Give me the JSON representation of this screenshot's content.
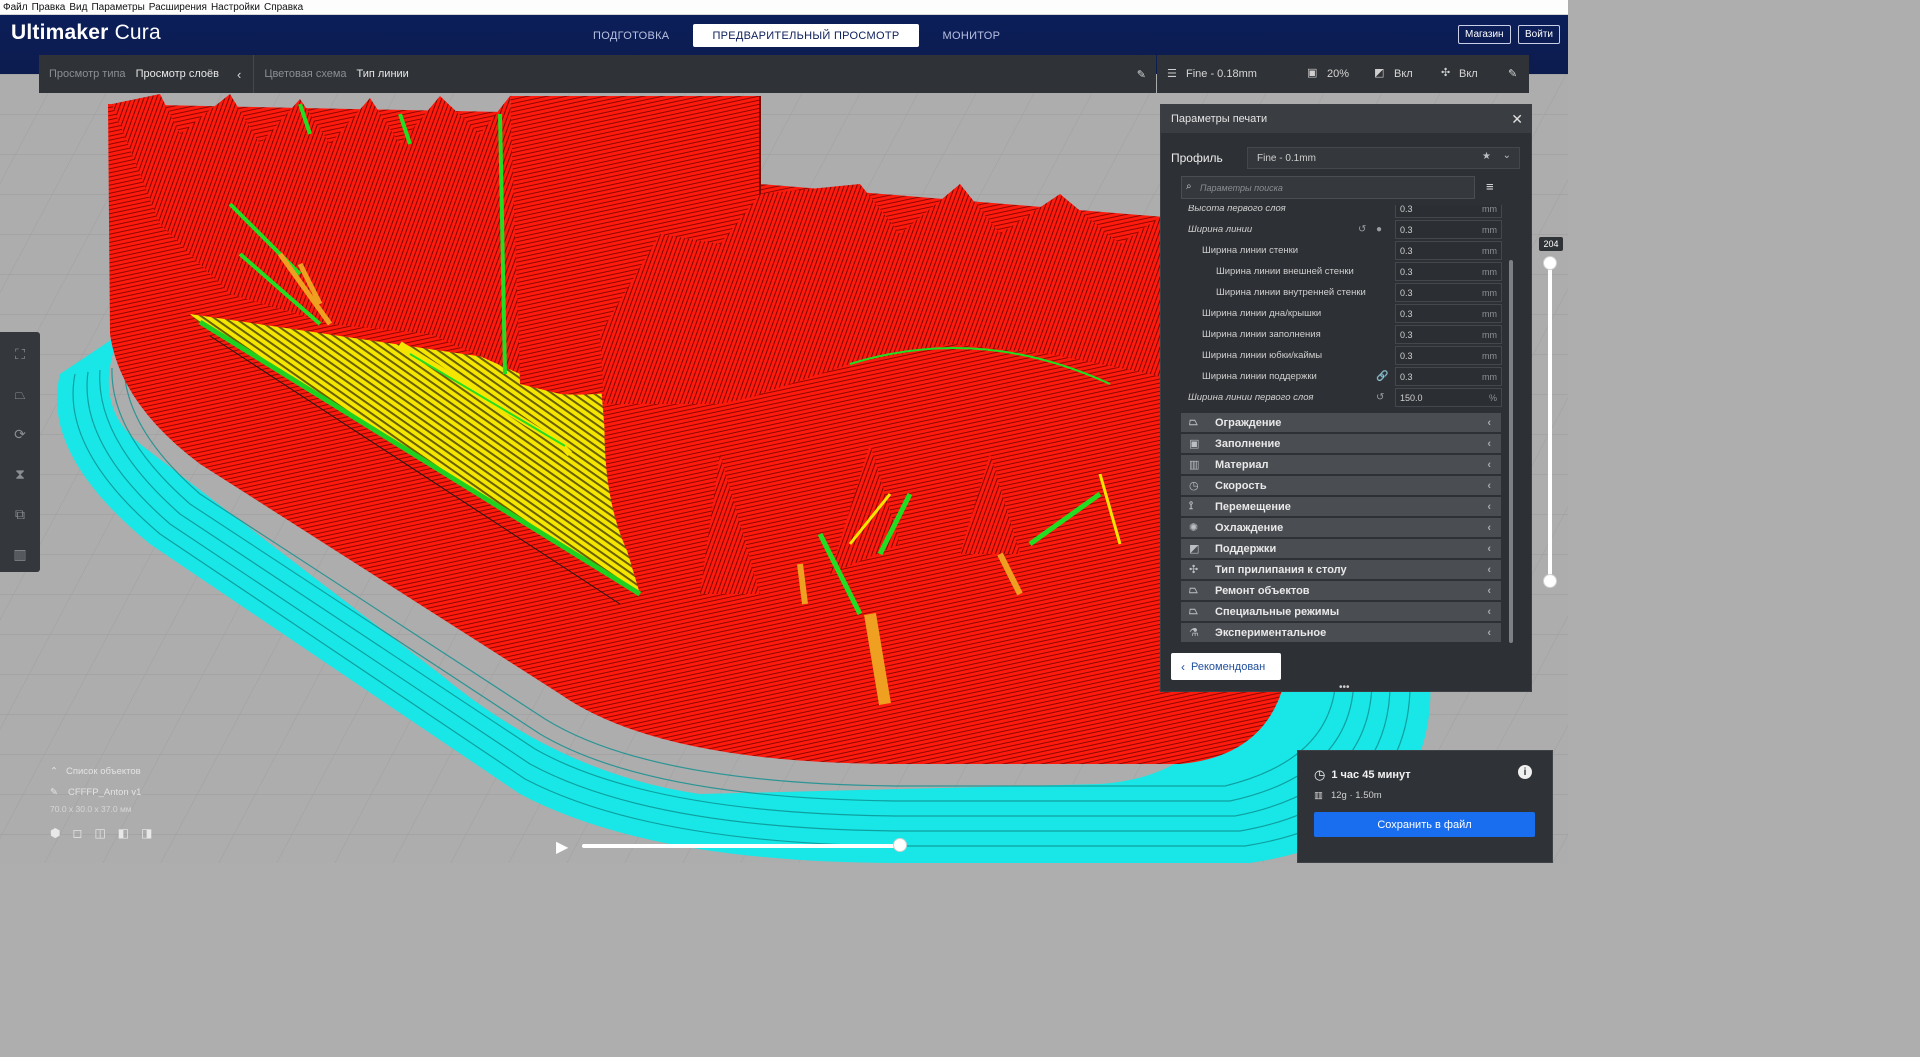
{
  "menu": [
    "Файл",
    "Правка",
    "Вид",
    "Параметры",
    "Расширения",
    "Настройки",
    "Справка"
  ],
  "header": {
    "brand_bold": "Ultimaker",
    "brand_light": "Cura",
    "tabs": [
      "ПОДГОТОВКА",
      "ПРЕДВАРИТЕЛЬНЫЙ ПРОСМОТР",
      "МОНИТОР"
    ],
    "active_tab": "ПРЕДВАРИТЕЛЬНЫЙ ПРОСМОТР",
    "marketplace": "Магазин",
    "signin": "Войти",
    "bg_color": "#0c1e5a"
  },
  "viewbar": {
    "view_type_label": "Просмотр типа",
    "view_type_value": "Просмотр слоёв",
    "color_scheme_label": "Цветовая схема",
    "color_scheme_value": "Тип линии"
  },
  "printbar": {
    "profile": "Fine - 0.18mm",
    "infill": "20%",
    "support": "Вкл",
    "adhesion": "Вкл"
  },
  "panel": {
    "title": "Параметры печати",
    "profile_label": "Профиль",
    "profile_value": "Fine - 0.1mm",
    "search_placeholder": "Параметры поиска",
    "cut_off_row": {
      "name": "Высота первого слоя",
      "value": "0.3",
      "unit": "mm"
    },
    "settings": [
      {
        "name": "Ширина линии",
        "value": "0.3",
        "unit": "mm"
      },
      {
        "name": "Ширина линии стенки",
        "value": "0.3",
        "unit": "mm"
      },
      {
        "name": "Ширина линии внешней стенки",
        "value": "0.3",
        "unit": "mm"
      },
      {
        "name": "Ширина линии внутренней стенки",
        "value": "0.3",
        "unit": "mm"
      },
      {
        "name": "Ширина линии дна/крышки",
        "value": "0.3",
        "unit": "mm"
      },
      {
        "name": "Ширина линии заполнения",
        "value": "0.3",
        "unit": "mm"
      },
      {
        "name": "Ширина линии юбки/каймы",
        "value": "0.3",
        "unit": "mm"
      },
      {
        "name": "Ширина линии поддержки",
        "value": "0.3",
        "unit": "mm"
      },
      {
        "name": "Ширина линии первого слоя",
        "value": "150.0",
        "unit": "%"
      }
    ],
    "categories": [
      "Ограждение",
      "Заполнение",
      "Материал",
      "Скорость",
      "Перемещение",
      "Охлаждение",
      "Поддержки",
      "Тип прилипания к столу",
      "Ремонт объектов",
      "Специальные режимы",
      "Экспериментальное"
    ],
    "recommended_button": "Рекомендован"
  },
  "layer_slider": {
    "value": "204"
  },
  "objects": {
    "list_label": "Список объектов",
    "object_name": "CFFFP_Anton v1",
    "dimensions": "70.0 x 30.0 x 37.0 мм"
  },
  "estimate": {
    "time": "1 час 45 минут",
    "material": "12g · 1.50m",
    "save_button": "Сохранить в файл",
    "accent": "#196ef0"
  },
  "colors": {
    "wall": "#ff1a0e",
    "skin": "#fff200",
    "inner": "#22dd22",
    "support_infill": "#f0a020",
    "skirt": "#19e6e6",
    "buildplate": "#adadad"
  }
}
